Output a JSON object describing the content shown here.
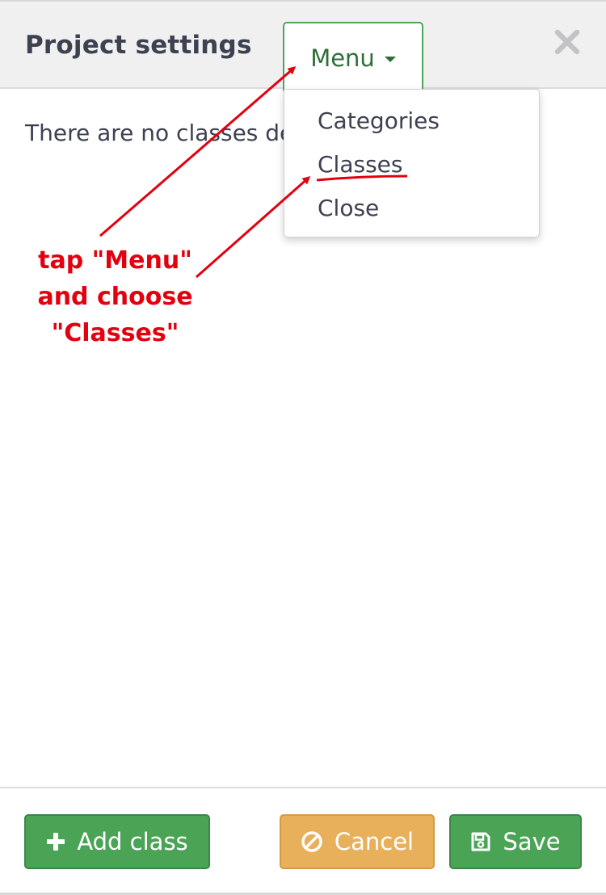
{
  "header": {
    "title": "Project settings",
    "menu_label": "Menu",
    "icons": {
      "menu_caret": "caret-down-icon",
      "close": "close-icon"
    }
  },
  "main": {
    "empty_text": "There are no classes de"
  },
  "dropdown": {
    "items": [
      {
        "label": "Categories"
      },
      {
        "label": "Classes"
      },
      {
        "label": "Close"
      }
    ]
  },
  "annotation": {
    "lines": [
      "tap \"Menu\"",
      "and choose",
      "\"Classes\""
    ],
    "color": "#e3000f"
  },
  "footer": {
    "add_label": "Add class",
    "cancel_label": "Cancel",
    "save_label": "Save",
    "icons": {
      "add": "plus-icon",
      "cancel": "ban-icon",
      "save": "floppy-disk-icon"
    }
  },
  "colors": {
    "primary_green": "#4ba456",
    "menu_green": "#2e6e39",
    "cancel_orange": "#e8b05a",
    "text": "#3d4150"
  }
}
